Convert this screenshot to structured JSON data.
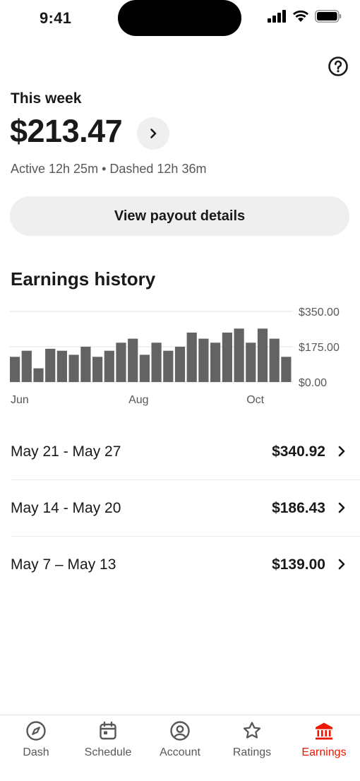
{
  "status_bar": {
    "time": "9:41"
  },
  "summary": {
    "week_label": "This week",
    "amount": "$213.47",
    "stats": "Active 12h 25m • Dashed 12h 36m",
    "payout_button": "View payout details"
  },
  "history": {
    "title": "Earnings history",
    "chart_data": {
      "type": "bar",
      "title": "",
      "xlabel": "",
      "ylabel": "",
      "ylim": [
        0,
        350
      ],
      "y_ticks": [
        "$350.00",
        "$175.00",
        "$0.00"
      ],
      "x_ticks": [
        {
          "label": "Jun",
          "index": 0
        },
        {
          "label": "Aug",
          "index": 10
        },
        {
          "label": "Oct",
          "index": 20
        }
      ],
      "grid": true,
      "values": [
        125,
        155,
        68,
        165,
        155,
        135,
        175,
        125,
        155,
        195,
        215,
        135,
        195,
        155,
        175,
        245,
        215,
        195,
        245,
        265,
        195,
        265,
        215,
        125
      ],
      "color": "#636363"
    },
    "weeks": [
      {
        "range": "May 21 - May 27",
        "amount": "$340.92"
      },
      {
        "range": "May 14 - May 20",
        "amount": "$186.43"
      },
      {
        "range": "May 7 – May 13",
        "amount": "$139.00"
      }
    ]
  },
  "tabs": [
    {
      "label": "Dash",
      "icon": "compass-icon",
      "active": false
    },
    {
      "label": "Schedule",
      "icon": "calendar-icon",
      "active": false
    },
    {
      "label": "Account",
      "icon": "user-circle-icon",
      "active": false
    },
    {
      "label": "Ratings",
      "icon": "star-icon",
      "active": false
    },
    {
      "label": "Earnings",
      "icon": "bank-icon",
      "active": true
    }
  ],
  "colors": {
    "accent": "#eb1700",
    "bar": "#636363",
    "text": "#191919",
    "muted": "#585858"
  }
}
